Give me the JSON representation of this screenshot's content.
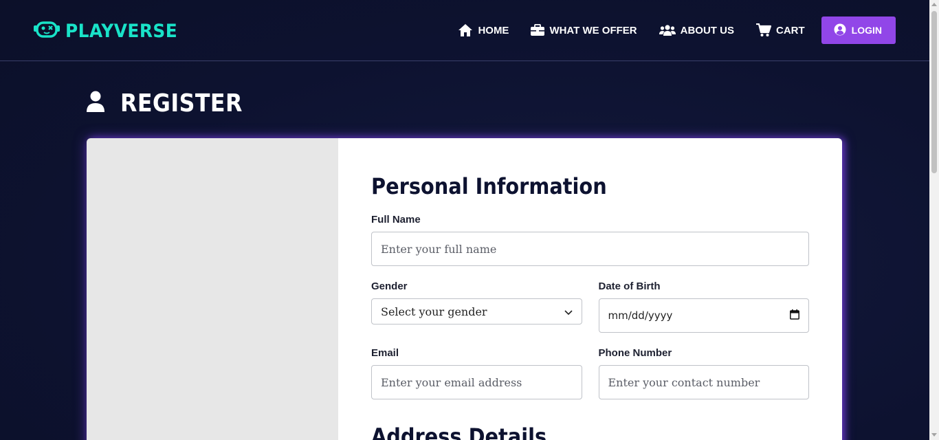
{
  "brand": {
    "name": "PLAYVERSE",
    "logo_icon": "gamepad-robot-icon",
    "color": "#19e3c8"
  },
  "nav": {
    "items": [
      {
        "label": "HOME",
        "icon": "home-icon"
      },
      {
        "label": "WHAT WE OFFER",
        "icon": "briefcase-icon"
      },
      {
        "label": "ABOUT US",
        "icon": "users-icon"
      },
      {
        "label": "CART",
        "icon": "cart-icon"
      }
    ],
    "login": {
      "label": "LOGIN",
      "icon": "user-circle-icon",
      "color": "#9146e8"
    }
  },
  "page": {
    "title": "REGISTER",
    "title_icon": "user-icon"
  },
  "form": {
    "personal_title": "Personal Information",
    "full_name": {
      "label": "Full Name",
      "placeholder": "Enter your full name"
    },
    "gender": {
      "label": "Gender",
      "selected": "Select your gender"
    },
    "dob": {
      "label": "Date of Birth",
      "value": "mm/dd/yyyy"
    },
    "email": {
      "label": "Email",
      "placeholder": "Enter your email address"
    },
    "phone": {
      "label": "Phone Number",
      "placeholder": "Enter your contact number"
    },
    "address_title": "Address Details"
  },
  "colors": {
    "background": "#0d1230",
    "accent": "#9146e8",
    "brand": "#19e3c8"
  }
}
